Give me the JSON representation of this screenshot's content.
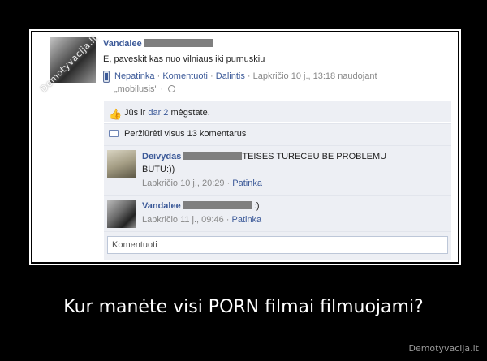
{
  "post": {
    "author": "Vandalee",
    "text": "E, paveskit kas nuo vilniaus iki purnuskiu",
    "actions": {
      "unlike": "Nepatinka",
      "comment": "Komentuoti",
      "share": "Dalintis",
      "timestamp": "Lapkričio 10 j., 13:18 naudojant",
      "via": "„mobilusis\""
    }
  },
  "likes": {
    "you": "Jūs ir",
    "others_link": "dar 2",
    "suffix": "mėgstate."
  },
  "view_all": "Peržiūrėti visus 13 komentarus",
  "comments": [
    {
      "author": "Deivydas",
      "text_line1": "TEISES TURECEU BE PROBLEMU",
      "text_line2": "BUTU:))",
      "timestamp": "Lapkričio 10 j., 20:29",
      "like_label": "Patinka"
    },
    {
      "author": "Vandalee",
      "text_line1": ":)",
      "timestamp": "Lapkričio 11 j., 09:46",
      "like_label": "Patinka"
    }
  ],
  "comment_input": {
    "placeholder": "Komentuoti"
  },
  "watermark": "Demotyvacija.lt",
  "caption": "Kur manėte visi PORN filmai filmuojami?",
  "brand": "Demotyvacija.lt",
  "icons": [
    "mobile-phone-icon",
    "thumbs-up-icon",
    "comment-bubble-icon",
    "globe-icon"
  ],
  "colors": {
    "link": "#3b5998",
    "row_bg": "#edeff4",
    "background": "#000000"
  }
}
